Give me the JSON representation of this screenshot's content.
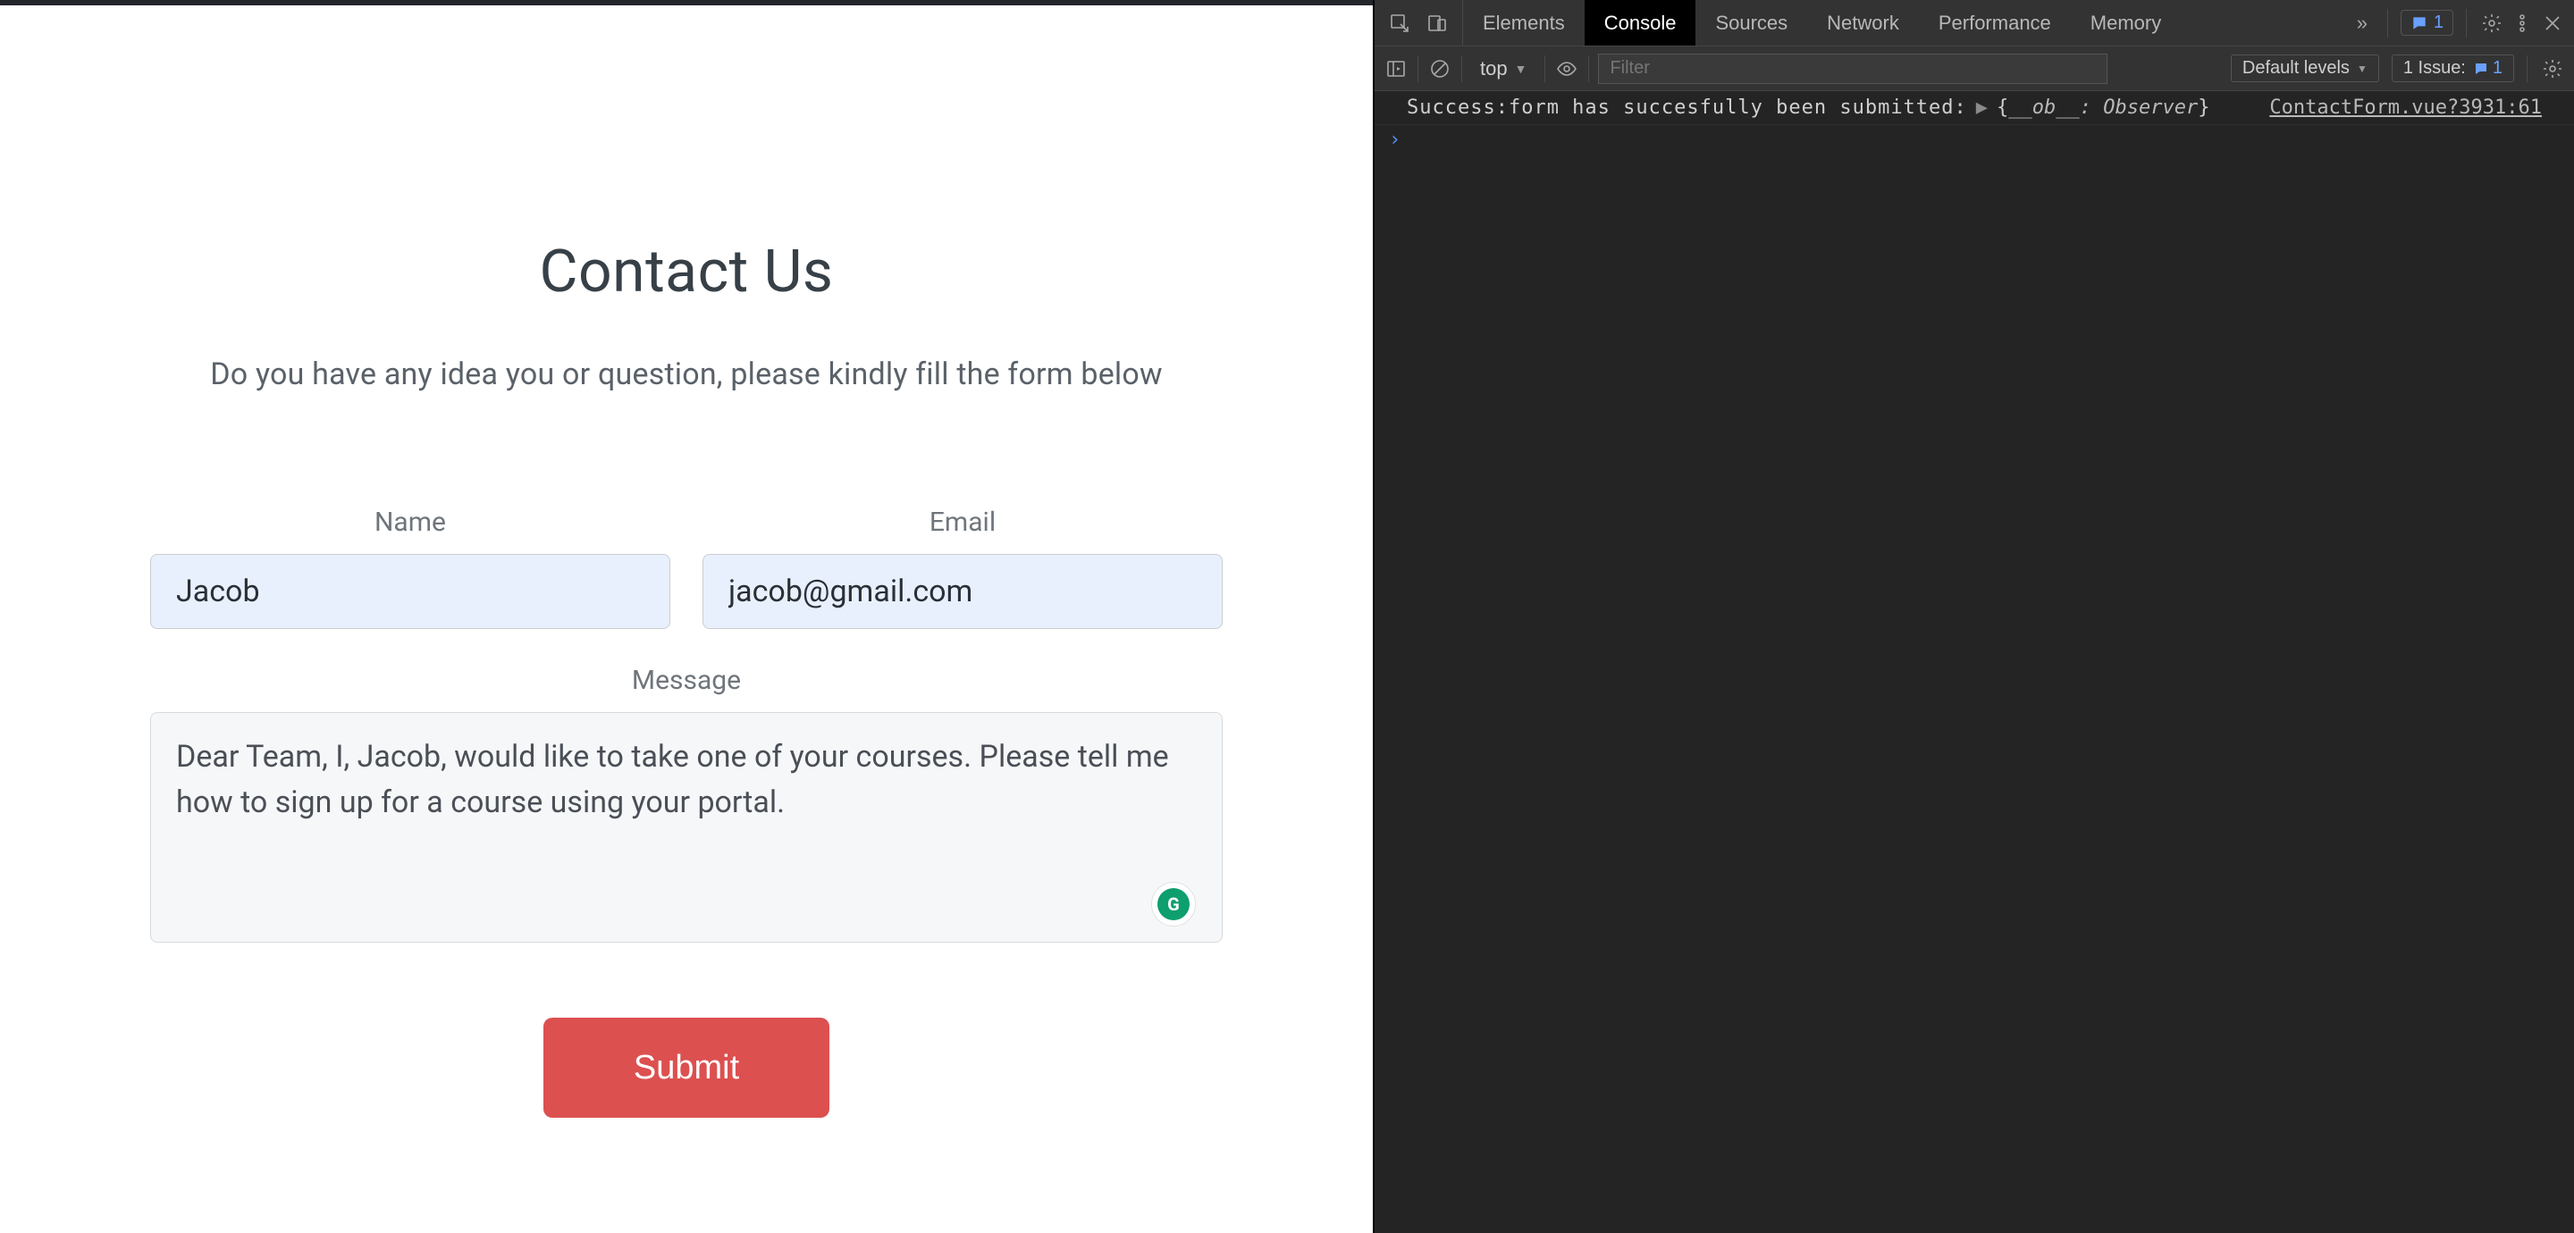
{
  "form": {
    "title": "Contact Us",
    "subtitle": "Do you have any idea you or question, please kindly fill the form below",
    "name_label": "Name",
    "name_value": "Jacob",
    "email_label": "Email",
    "email_value": "jacob@gmail.com",
    "message_label": "Message",
    "message_value": "Dear Team, I, Jacob, would like to take one of your courses. Please tell me how to sign up for a course using your portal.",
    "submit_label": "Submit",
    "grammarly_badge": "G"
  },
  "devtools": {
    "tabs": [
      "Elements",
      "Console",
      "Sources",
      "Network",
      "Performance",
      "Memory"
    ],
    "active_tab": "Console",
    "more_glyph": "»",
    "message_count": "1",
    "context_label": "top",
    "filter_placeholder": "Filter",
    "levels_label": "Default levels",
    "issues_label": "1 Issue:",
    "issues_count": "1",
    "log": {
      "message": "Success:form has succesfully been submitted:",
      "expand_glyph": "▶",
      "object_open": "{",
      "object_key": "__ob__",
      "object_sep": ": ",
      "object_val": "Observer",
      "object_close": "}",
      "source": "ContactForm.vue?3931:61"
    },
    "prompt_glyph": "›"
  }
}
